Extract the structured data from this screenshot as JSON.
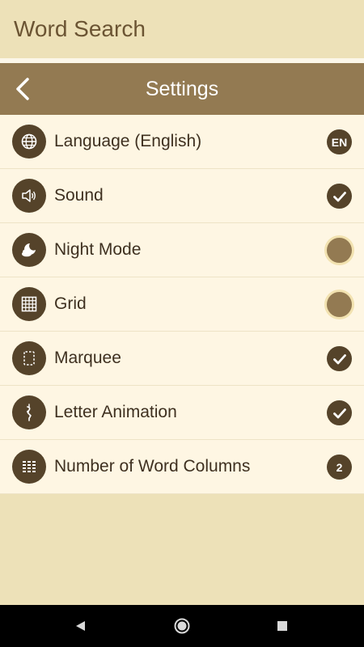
{
  "app_title": "Word Search",
  "header": {
    "title": "Settings",
    "back_icon": "chevron-left-icon"
  },
  "settings": [
    {
      "label": "Language (English)",
      "icon": "globe-icon",
      "control": "badge",
      "value": "EN"
    },
    {
      "label": "Sound",
      "icon": "speaker-icon",
      "control": "check",
      "value": "on"
    },
    {
      "label": "Night Mode",
      "icon": "moon-cloud-icon",
      "control": "toggle",
      "value": "off"
    },
    {
      "label": "Grid",
      "icon": "grid-icon",
      "control": "toggle",
      "value": "off"
    },
    {
      "label": "Marquee",
      "icon": "marquee-icon",
      "control": "check",
      "value": "on"
    },
    {
      "label": "Letter Animation",
      "icon": "letter-animation-icon",
      "control": "check",
      "value": "on"
    },
    {
      "label": "Number of Word Columns",
      "icon": "columns-icon",
      "control": "badge",
      "value": "2"
    }
  ],
  "navbar": {
    "back": "back-triangle-icon",
    "home": "home-circle-icon",
    "recents": "recents-square-icon"
  },
  "colors": {
    "background": "#ede1b8",
    "header": "#937a52",
    "row": "#fef6e3",
    "icon_dark": "#55432a",
    "text": "#3e3020"
  }
}
